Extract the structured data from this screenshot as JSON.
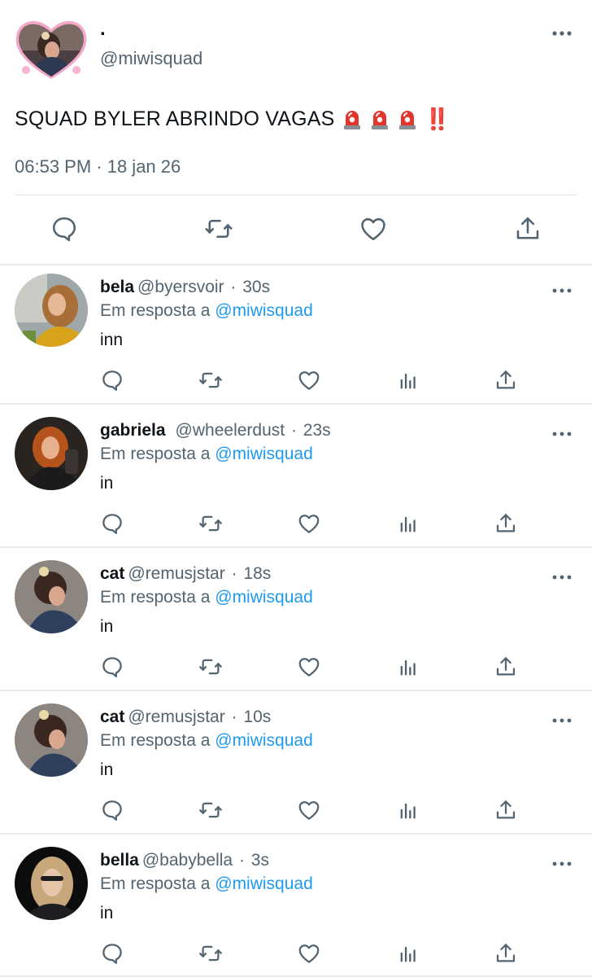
{
  "main_tweet": {
    "display_name": ".",
    "handle": "@miwisquad",
    "text": "SQUAD BYLER ABRINDO VAGAS",
    "emoji": {
      "siren": "police-car-light",
      "count": 3,
      "bang": "‼️"
    },
    "timestamp": "06:53 PM · 18 jan 26",
    "actions": [
      "reply-icon",
      "retweet-icon",
      "like-icon",
      "share-icon"
    ]
  },
  "replies": [
    {
      "name": "bela",
      "handle": "@byersvoir",
      "sep": "·",
      "time": "30s",
      "reply_prefix": "Em resposta a",
      "reply_to": "@miwisquad",
      "text": "inn"
    },
    {
      "name": "gabriela",
      "handle": "@wheelerdust",
      "sep": "·",
      "time": "23s",
      "reply_prefix": "Em resposta a",
      "reply_to": "@miwisquad",
      "text": "in"
    },
    {
      "name": "cat",
      "handle": "@remusjstar",
      "sep": "·",
      "time": "18s",
      "reply_prefix": "Em resposta a",
      "reply_to": "@miwisquad",
      "text": "in"
    },
    {
      "name": "cat",
      "handle": "@remusjstar",
      "sep": "·",
      "time": "10s",
      "reply_prefix": "Em resposta a",
      "reply_to": "@miwisquad",
      "text": "in"
    },
    {
      "name": "bella",
      "handle": "@babybella",
      "sep": "·",
      "time": "3s",
      "reply_prefix": "Em resposta a",
      "reply_to": "@miwisquad",
      "text": "in"
    }
  ],
  "colors": {
    "text": "#0f1419",
    "secondary": "#536471",
    "link": "#1d9bf0",
    "icon": "#536471",
    "divider": "#e9ecef"
  }
}
